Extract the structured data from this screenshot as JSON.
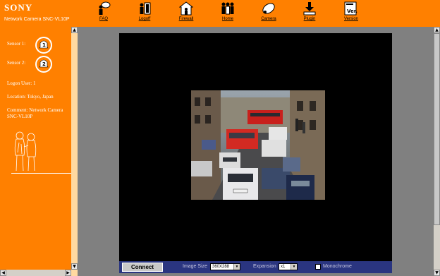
{
  "header": {
    "brand": "SONY",
    "model": "Network Camera SNC-VL10P",
    "toolbar": [
      {
        "label": "FAQ",
        "icon": "faq-icon"
      },
      {
        "label": "Logoff",
        "icon": "logoff-icon"
      },
      {
        "label": "Firewall",
        "icon": "firewall-icon"
      },
      {
        "label": "Home",
        "icon": "home-icon"
      },
      {
        "label": "Camera",
        "icon": "camera-icon"
      },
      {
        "label": "Plugin",
        "icon": "plugin-icon"
      },
      {
        "label": "Version",
        "icon": "version-icon"
      }
    ]
  },
  "sidebar": {
    "sensors": [
      {
        "label": "Sensor 1:",
        "number": "1"
      },
      {
        "label": "Sensor 2:",
        "number": "2"
      }
    ],
    "logon_user": "Logon User: 1",
    "location": "Location: Tokyo, Japan",
    "comment": "Comment: Network Camera SNC-VL10P"
  },
  "controls": {
    "connect_label": "Connect",
    "image_size_label": "Image Size",
    "image_size_value": "360X288",
    "expansion_label": "Expansion",
    "expansion_value": "x1",
    "monochrome_label": "Monochrome",
    "monochrome_checked": false
  },
  "colors": {
    "accent": "#ff8000",
    "control_bar": "#2a3580",
    "video_bg": "#000000"
  }
}
